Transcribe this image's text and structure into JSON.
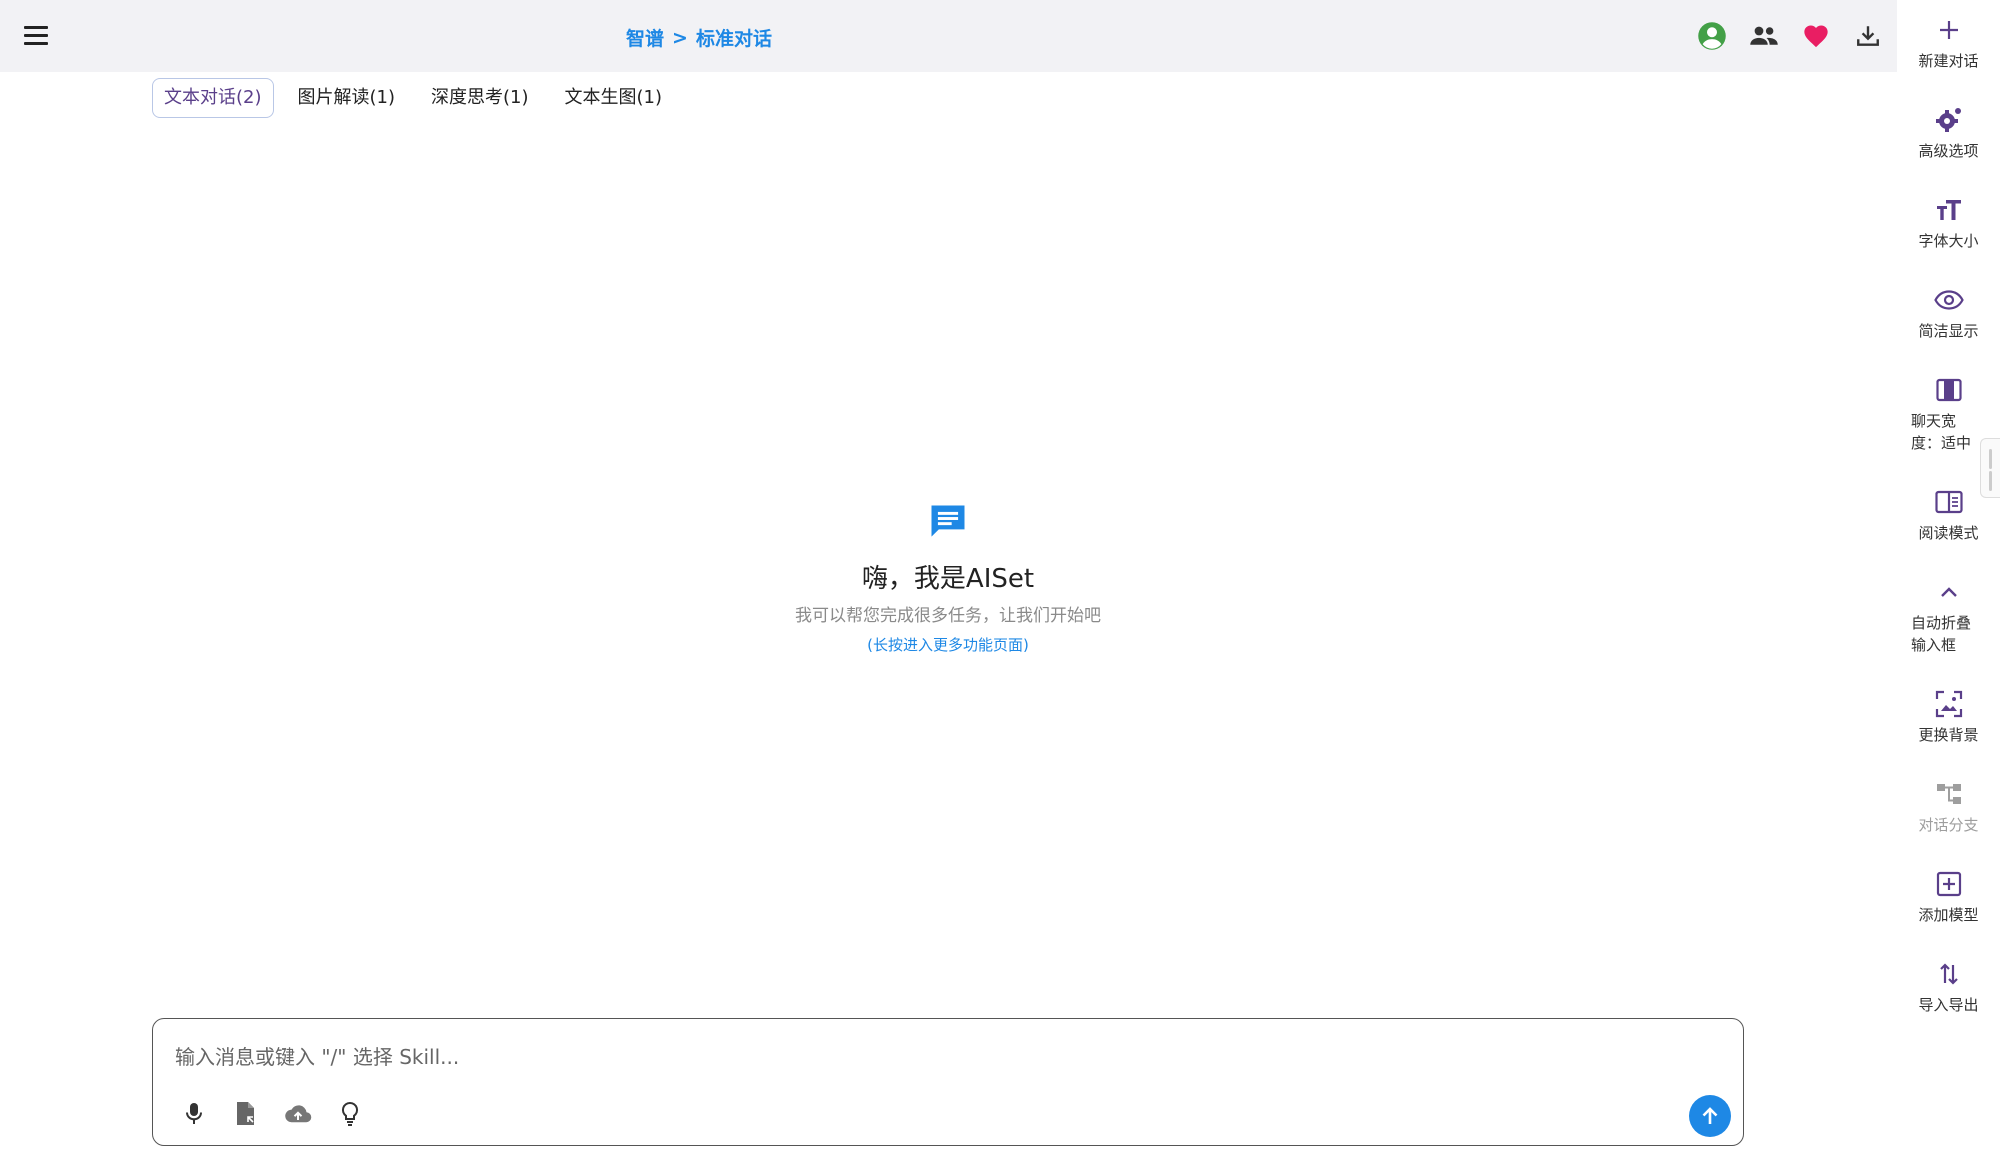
{
  "header": {
    "breadcrumb": {
      "provider": "智谱",
      "separator": ">",
      "mode": "标准对话"
    },
    "icons": [
      {
        "name": "account-circle-icon",
        "color": "#43a047"
      },
      {
        "name": "people-icon",
        "color": "#333333"
      },
      {
        "name": "heart-icon",
        "color": "#e91e63"
      },
      {
        "name": "download-icon",
        "color": "#333333"
      }
    ]
  },
  "tabs": [
    {
      "label": "文本对话(2)",
      "active": true
    },
    {
      "label": "图片解读(1)",
      "active": false
    },
    {
      "label": "深度思考(1)",
      "active": false
    },
    {
      "label": "文本生图(1)",
      "active": false
    }
  ],
  "welcome": {
    "title": "嗨，我是AISet",
    "subtitle": "我可以帮您完成很多任务，让我们开始吧",
    "hint": "(长按进入更多功能页面)"
  },
  "input": {
    "placeholder": "输入消息或键入 \"/\" 选择 Skill...",
    "tools": [
      "microphone-icon",
      "file-import-icon",
      "cloud-upload-icon",
      "lightbulb-icon"
    ]
  },
  "sidebar": {
    "items": [
      {
        "label": "新建对话",
        "icon": "plus-icon"
      },
      {
        "label": "高级选项",
        "icon": "cog-icon"
      },
      {
        "label": "字体大小",
        "icon": "font-size-icon"
      },
      {
        "label": "简洁显示",
        "icon": "eye-icon"
      },
      {
        "label": "聊天宽度：适中",
        "line1": "聊天宽",
        "line2": "度：适中",
        "icon": "column-width-icon"
      },
      {
        "label": "阅读模式",
        "icon": "book-open-icon"
      },
      {
        "label": "自动折叠输入框",
        "line1": "自动折叠",
        "line2": "输入框",
        "icon": "chevron-up-icon"
      },
      {
        "label": "更换背景",
        "icon": "image-frame-icon"
      },
      {
        "label": "对话分支",
        "icon": "branch-icon",
        "disabled": true
      },
      {
        "label": "添加模型",
        "icon": "plus-box-icon"
      },
      {
        "label": "导入导出",
        "icon": "swap-vertical-icon"
      }
    ]
  },
  "colors": {
    "accent": "#1e88e5",
    "purple": "#5a3f8a",
    "header_bg": "#f2f2f5"
  }
}
